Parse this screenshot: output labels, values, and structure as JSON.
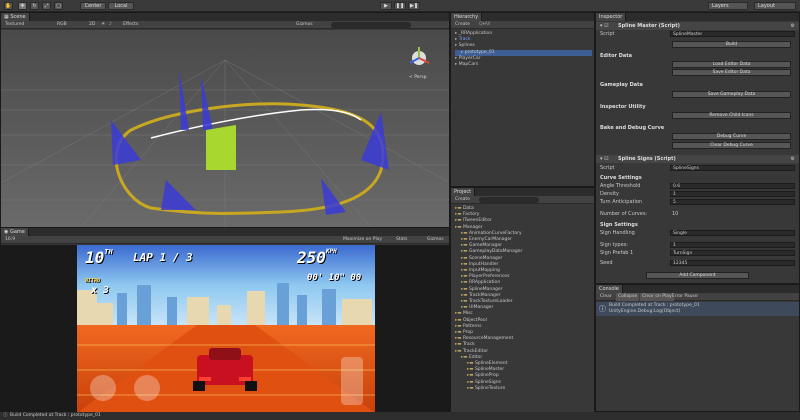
{
  "toolbar": {
    "play": "▶",
    "pause": "❚❚",
    "step": "▶❚",
    "center": "Center",
    "local": "Local",
    "layers": "Layers",
    "layout": "Layout"
  },
  "scene": {
    "tab": "Scene",
    "shading": "Textured",
    "rgb": "RGB",
    "twod": "2D",
    "effects": "Effects",
    "gizmos": "Gizmos",
    "persp": "< Persp"
  },
  "game": {
    "tab": "Game",
    "aspect": "16:9",
    "maximize": "Maximize on Play",
    "stats": "Stats",
    "gizmos": "Gizmos",
    "hud": {
      "position": "10",
      "position_suffix": "TH",
      "lap": "LAP 1 / 3",
      "speed": "250",
      "speed_unit": "KPH",
      "nitro_label": "NITRO",
      "nitro_count": "x 3",
      "time": "00' 10\" 00"
    }
  },
  "hierarchy": {
    "tab": "Hierarchy",
    "create": "Create",
    "search": "Q▾All",
    "items": [
      {
        "label": "_RRApplication",
        "indent": 0
      },
      {
        "label": "Track",
        "indent": 0,
        "highlight": true
      },
      {
        "label": "Splines",
        "indent": 0
      },
      {
        "label": "prototype_01",
        "indent": 1,
        "selected": true
      },
      {
        "label": "PlayerCar",
        "indent": 0
      },
      {
        "label": "MapCars",
        "indent": 0
      }
    ]
  },
  "project": {
    "tab": "Project",
    "create": "Create",
    "items": [
      {
        "label": "Data",
        "indent": 0
      },
      {
        "label": "Factory",
        "indent": 0
      },
      {
        "label": "ITweenEditor",
        "indent": 0
      },
      {
        "label": "Manager",
        "indent": 0
      },
      {
        "label": "AnimationCurveFactory",
        "indent": 1
      },
      {
        "label": "EnemyCarManager",
        "indent": 1
      },
      {
        "label": "GameManager",
        "indent": 1
      },
      {
        "label": "GameplayDataManager",
        "indent": 1
      },
      {
        "label": "SceneManager",
        "indent": 1
      },
      {
        "label": "InputHandler",
        "indent": 1
      },
      {
        "label": "InputMapping",
        "indent": 1
      },
      {
        "label": "PlayerPreferences",
        "indent": 1
      },
      {
        "label": "RRApplication",
        "indent": 1
      },
      {
        "label": "SplineManager",
        "indent": 1
      },
      {
        "label": "TrackManager",
        "indent": 1
      },
      {
        "label": "TrackTextureLoader",
        "indent": 1
      },
      {
        "label": "UIManager",
        "indent": 1
      },
      {
        "label": "Misc",
        "indent": 0
      },
      {
        "label": "ObjectPool",
        "indent": 0
      },
      {
        "label": "Patterns",
        "indent": 0
      },
      {
        "label": "Prop",
        "indent": 0
      },
      {
        "label": "ResourceManagement",
        "indent": 0
      },
      {
        "label": "Track",
        "indent": 0
      },
      {
        "label": "TrackEditor",
        "indent": 0
      },
      {
        "label": "Editor",
        "indent": 1
      },
      {
        "label": "SplineElement",
        "indent": 2
      },
      {
        "label": "SplineMaster",
        "indent": 2
      },
      {
        "label": "SplineProp",
        "indent": 2
      },
      {
        "label": "SplineSigns",
        "indent": 2
      },
      {
        "label": "SplineTexture",
        "indent": 2
      }
    ]
  },
  "inspector": {
    "tab": "Inspector",
    "master": {
      "title": "Spline Master (Script)",
      "script_label": "Script",
      "script_value": "SplineMaster",
      "build": "Build",
      "editor_data": "Editor Data",
      "load_editor": "Load Editor Data",
      "save_editor": "Save Editor Data",
      "gameplay_data": "Gameplay Data",
      "save_gameplay": "Save Gameplay Data",
      "inspector_utility": "Inspector Utility",
      "remove_child": "Remove Child Icons",
      "bake_debug": "Bake and Debug Curve",
      "debug_curve": "Debug Curve",
      "clear_debug": "Clear Debug Curve"
    },
    "signs": {
      "title": "Spline Signs (Script)",
      "script_label": "Script",
      "script_value": "SplineSigns",
      "curve_settings": "Curve Settings",
      "angle_label": "Angle Threshold",
      "angle_value": "0.6",
      "density_label": "Density",
      "density_value": "1",
      "turn_label": "Turn Anticipation",
      "turn_value": "5",
      "curves_label": "Number of Curves:",
      "curves_value": "10",
      "sign_settings": "Sign Settings",
      "handling_label": "Sign Handling",
      "handling_value": "Single",
      "types_label": "Sign types:",
      "types_value": "1",
      "prefab_label": "Sign Prefab 1",
      "prefab_value": "TurnSign",
      "seed_label": "Seed",
      "seed_value": "12345"
    },
    "add_component": "Add Component"
  },
  "console": {
    "tab": "Console",
    "clear": "Clear",
    "collapse": "Collapse",
    "clear_on_play": "Clear on Play",
    "error_pause": "Error Pause",
    "line1": "Build Completed at Track : prototype_01",
    "line2": "UnityEngine.Debug:Log(Object)"
  },
  "status": {
    "text": "Build Completed at Track : prototype_01"
  }
}
